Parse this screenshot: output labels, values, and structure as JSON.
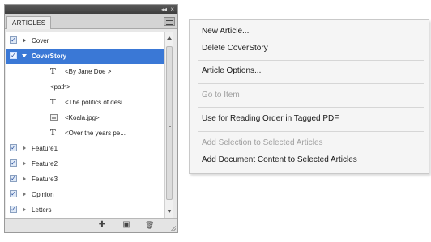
{
  "panel": {
    "tab_label": "ARTICLES",
    "collapse_glyph": "◂◂",
    "close_glyph": "×",
    "rows": [
      {
        "label": "Cover",
        "type": "article",
        "checked": true,
        "expanded": false
      },
      {
        "label": "CoverStory",
        "type": "article",
        "checked": true,
        "expanded": true,
        "selected": true
      },
      {
        "label": "<By Jane Doe >",
        "type": "text"
      },
      {
        "label": "<path>",
        "type": "path"
      },
      {
        "label": "<The politics of desi...",
        "type": "text"
      },
      {
        "label": "<Koala.jpg>",
        "type": "image"
      },
      {
        "label": "<Over the years pe...",
        "type": "text"
      },
      {
        "label": "Feature1",
        "type": "article",
        "checked": true,
        "expanded": false
      },
      {
        "label": "Feature2",
        "type": "article",
        "checked": true,
        "expanded": false
      },
      {
        "label": "Feature3",
        "type": "article",
        "checked": true,
        "expanded": false
      },
      {
        "label": "Opinion",
        "type": "article",
        "checked": true,
        "expanded": false
      },
      {
        "label": "Letters",
        "type": "article",
        "checked": true,
        "expanded": false
      }
    ],
    "text_icon_glyph": "T",
    "checkmark": "✓",
    "bottom_icons": [
      "add-content-icon",
      "new-article-icon",
      "delete-icon"
    ],
    "bottom_glyphs": [
      "✚",
      "▣",
      "🗑"
    ]
  },
  "menu": {
    "items": [
      {
        "label": "New Article...",
        "enabled": true
      },
      {
        "label": "Delete CoverStory",
        "enabled": true
      },
      {
        "label": "Article Options...",
        "enabled": true
      },
      {
        "label": "Go to Item",
        "enabled": false
      },
      {
        "label": "Use for Reading Order in Tagged PDF",
        "enabled": true
      },
      {
        "label": "Add Selection to Selected Articles",
        "enabled": false
      },
      {
        "label": "Add Document Content to Selected Articles",
        "enabled": true
      }
    ]
  },
  "colors": {
    "selection": "#3a78d6",
    "panel_bg": "#e8e8e8",
    "menu_bg": "#f5f5f5",
    "disabled_text": "#a0a0a0"
  }
}
